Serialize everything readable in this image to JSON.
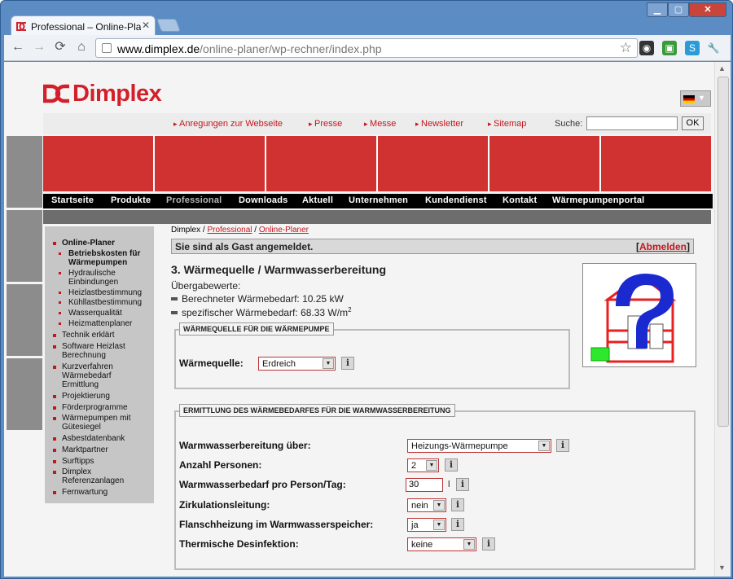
{
  "browser": {
    "tab_title": "Professional – Online-Plan",
    "url_host": "www.dimplex.de",
    "url_path": "/online-planer/wp-rechner/index.php"
  },
  "site": {
    "logo": "Dimplex",
    "top_links": [
      "Anregungen zur Webseite",
      "Presse",
      "Messe",
      "Newsletter",
      "Sitemap"
    ],
    "search_label": "Suche:",
    "search_button": "OK",
    "main_nav": [
      "Startseite",
      "Produkte",
      "Professional",
      "Downloads",
      "Aktuell",
      "Unternehmen",
      "Kundendienst",
      "Kontakt",
      "Wärmepumpenportal"
    ],
    "main_nav_active": "Professional"
  },
  "sidebar": {
    "items": [
      {
        "label": "Online-Planer",
        "bold": true
      },
      {
        "label": "Betriebskosten für",
        "label2": "Wärmepumpen",
        "bold": true,
        "sub": true
      },
      {
        "label": "Hydraulische",
        "label2": "Einbindungen",
        "sub": true
      },
      {
        "label": "Heizlastbestimmung",
        "sub": true
      },
      {
        "label": "Kühllastbestimmung",
        "sub": true
      },
      {
        "label": "Wasserqualität",
        "sub": true
      },
      {
        "label": "Heizmattenplaner",
        "sub": true
      },
      {
        "label": "Technik erklärt"
      },
      {
        "label": "Software Heizlast",
        "label2": "Berechnung"
      },
      {
        "label": "Kurzverfahren",
        "label2": "Wärmebedarf",
        "label3": "Ermittlung"
      },
      {
        "label": "Projektierung"
      },
      {
        "label": "Förderprogramme"
      },
      {
        "label": "Wärmepumpen mit",
        "label2": "Gütesiegel"
      },
      {
        "label": "Asbestdatenbank"
      },
      {
        "label": "Marktpartner"
      },
      {
        "label": "Surftipps"
      },
      {
        "label": "Dimplex",
        "label2": "Referenzanlagen"
      },
      {
        "label": "Fernwartung"
      }
    ]
  },
  "breadcrumb": {
    "root": "Dimplex",
    "sep": "/",
    "level1": "Professional",
    "level2": "Online-Planer"
  },
  "login": {
    "text": "Sie sind als Gast angemeldet.",
    "logout_open": "[",
    "logout_label": "Abmelden",
    "logout_close": "]"
  },
  "main": {
    "heading": "3. Wärmequelle / Warmwasserbereitung",
    "transfer_label": "Übergabewerte:",
    "transfer_values": [
      {
        "label": "Berechneter Wärmebedarf:",
        "value": "10.25 kW"
      },
      {
        "label": "spezifischer Wärmebedarf:",
        "value": "68.33 W/m",
        "sup": "2"
      }
    ]
  },
  "section1": {
    "legend": "WÄRMEQUELLE FÜR DIE WÄRMEPUMPE",
    "field_label": "Wärmequelle:",
    "value": "Erdreich"
  },
  "section2": {
    "legend": "ERMITTLUNG DES WÄRMEBEDARFES FÜR DIE WARMWASSERBEREITUNG",
    "fields": [
      {
        "label": "Warmwasserbereitung über:",
        "value": "Heizungs-Wärmepumpe"
      },
      {
        "label": "Anzahl Personen:",
        "value": "2"
      },
      {
        "label": "Warmwasserbedarf pro Person/Tag:",
        "value": "30",
        "unit": "l"
      },
      {
        "label": "Zirkulationsleitung:",
        "value": "nein"
      },
      {
        "label": "Flanschheizung im Warmwasserspeicher:",
        "value": "ja"
      },
      {
        "label": "Thermische Desinfektion:",
        "value": "keine"
      }
    ]
  },
  "icons": {
    "info": "i",
    "dropdown": "▼"
  }
}
